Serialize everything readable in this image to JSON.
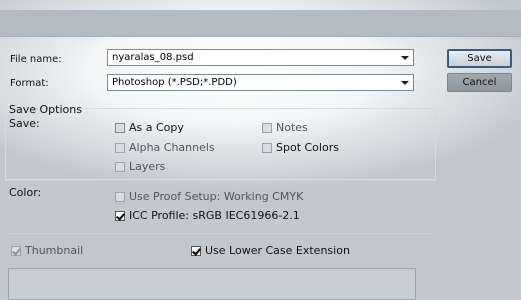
{
  "dialog": {
    "file_name_label": "File name:",
    "file_name_value": "nyaralas_08.psd",
    "format_label": "Format:",
    "format_value": "Photoshop (*.PSD;*.PDD)",
    "save_button": "Save",
    "cancel_button": "Cancel"
  },
  "save_options": {
    "title": "Save Options",
    "save_label": "Save:",
    "as_a_copy": "As a Copy",
    "notes": "Notes",
    "alpha_channels": "Alpha Channels",
    "spot_colors": "Spot Colors",
    "layers": "Layers"
  },
  "color": {
    "label": "Color:",
    "use_proof_setup": "Use Proof Setup:  Working CMYK",
    "icc_profile": "ICC Profile:  sRGB IEC61966-2.1"
  },
  "options": {
    "thumbnail": "Thumbnail",
    "lower_case_ext": "Use Lower Case Extension"
  }
}
